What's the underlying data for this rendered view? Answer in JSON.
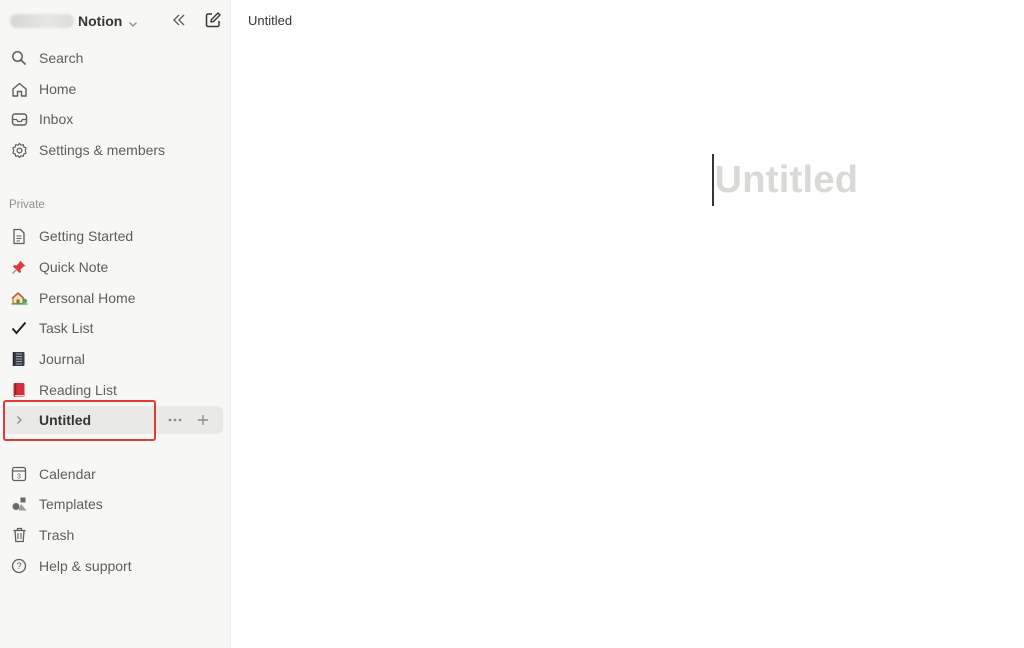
{
  "sidebar": {
    "workspace_name": "Notion",
    "top_items": [
      {
        "label": "Search",
        "icon": "search-icon"
      },
      {
        "label": "Home",
        "icon": "home-icon"
      },
      {
        "label": "Inbox",
        "icon": "inbox-icon"
      },
      {
        "label": "Settings & members",
        "icon": "gear-icon"
      }
    ],
    "section_label": "Private",
    "pages": [
      {
        "label": "Getting Started",
        "icon": "page-icon"
      },
      {
        "label": "Quick Note",
        "icon": "pushpin-icon"
      },
      {
        "label": "Personal Home",
        "icon": "house-garden-icon"
      },
      {
        "label": "Task List",
        "icon": "checkmark-icon"
      },
      {
        "label": "Journal",
        "icon": "notebook-icon"
      },
      {
        "label": "Reading List",
        "icon": "red-book-icon"
      },
      {
        "label": "Untitled",
        "icon": "chevron-right-icon",
        "selected": true
      }
    ],
    "bottom_items": [
      {
        "label": "Calendar",
        "icon": "calendar-icon",
        "icon_text": "3"
      },
      {
        "label": "Templates",
        "icon": "templates-icon"
      },
      {
        "label": "Trash",
        "icon": "trash-icon"
      },
      {
        "label": "Help & support",
        "icon": "help-icon"
      }
    ]
  },
  "topbar": {
    "breadcrumb": "Untitled"
  },
  "page": {
    "title_placeholder": "Untitled"
  },
  "colors": {
    "sidebar_bg": "#f7f7f5",
    "highlight": "#e53935",
    "placeholder": "#d9d9d6"
  }
}
